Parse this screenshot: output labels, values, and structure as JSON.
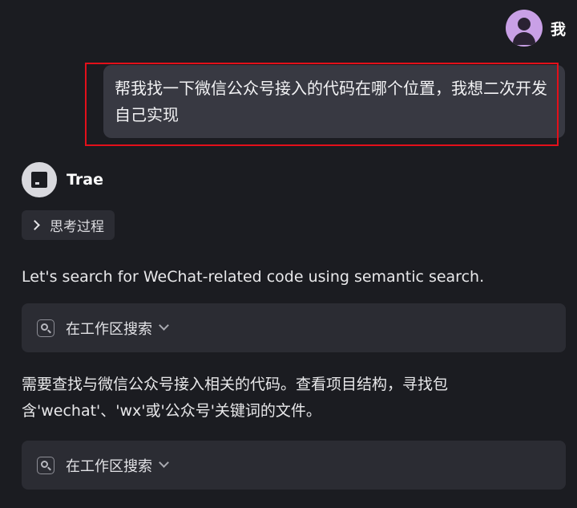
{
  "user": {
    "name": "我",
    "message": "帮我找一下微信公众号接入的代码在哪个位置，我想二次开发自己实现"
  },
  "assistant": {
    "name": "Trae",
    "thinking_label": "思考过程",
    "message_1": "Let's search for WeChat-related code using semantic search.",
    "tool_1": {
      "label": "在工作区搜索"
    },
    "message_2": "需要查找与微信公众号接入相关的代码。查看项目结构，寻找包含'wechat'、'wx'或'公众号'关键词的文件。",
    "tool_2": {
      "label": "在工作区搜索"
    }
  },
  "colors": {
    "background": "#1b1c21",
    "bubble": "#383942",
    "card": "#2b2c33",
    "highlight": "#e3101a",
    "avatar": "#c9a0e6"
  },
  "icons": [
    "user-avatar-icon",
    "trae-logo-icon",
    "chevron-right-icon",
    "search-icon",
    "chevron-down-icon"
  ]
}
